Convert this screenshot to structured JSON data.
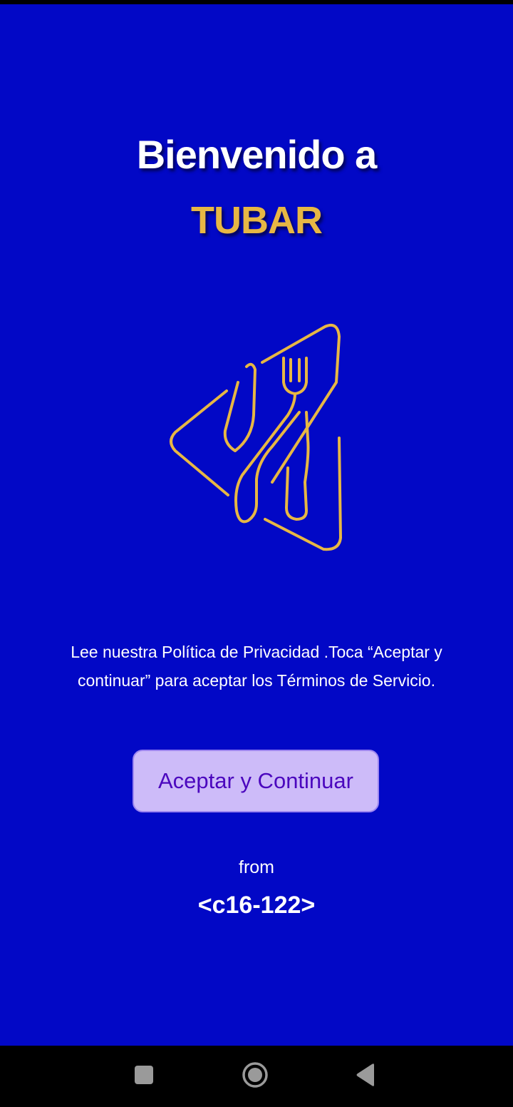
{
  "welcome": {
    "title": "Bienvenido a",
    "brand": "TUBAR"
  },
  "logo": {
    "icon": "restaurant-fork-knife-logo",
    "color": "#e7b744"
  },
  "notice": {
    "text": "Lee nuestra Política de Privacidad .Toca “Aceptar y continuar” para aceptar los Términos de Servicio."
  },
  "accept_button": {
    "label": "Aceptar y Continuar"
  },
  "footer": {
    "from_label": "from",
    "device_label": "<c16-122>"
  },
  "nav_bar": {
    "recents_icon": "square-icon",
    "home_icon": "circle-icon",
    "back_icon": "triangle-back-icon"
  },
  "colors": {
    "background": "#0208c6",
    "brand": "#e7b744",
    "button_bg": "#cdbbf9",
    "button_text": "#4b07be"
  }
}
